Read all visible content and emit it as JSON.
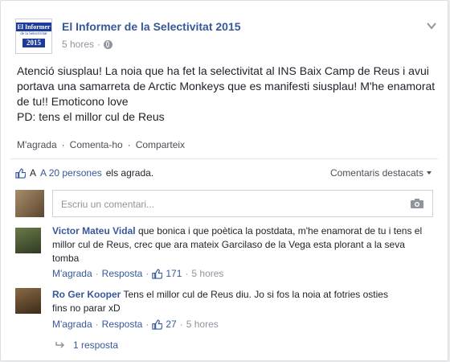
{
  "page": {
    "name": "El Informer de la Selectivitat 2015",
    "logo_text_top": "El Informer",
    "logo_text_mid": "de la Selectivitat",
    "logo_text_year": "2015",
    "time": "5 hores",
    "privacy_icon": "globe-icon"
  },
  "post": {
    "text": "Atenció siusplau! La noia que ha fet la selectivitat al INS Baix Camp de Reus i avui portava una samarreta de Arctic Monkeys que es manifesti siusplau! M'he enamorat de tu!! Emoticono love\nPD: tens el millor cul de Reus",
    "actions": {
      "like": "M'agrada",
      "comment": "Comenta-ho",
      "share": "Comparteix"
    }
  },
  "likes": {
    "prefix": "A",
    "count_label": "20 persones",
    "suffix": "els agrada.",
    "top_comments": "Comentaris destacats"
  },
  "comment_input": {
    "placeholder": "Escriu un comentari..."
  },
  "comments": [
    {
      "author": "Victor Mateu Vidal",
      "text": "que bonica i que poètica la postdata, m'he enamorat de tu i tens el millor cul de Reus, crec que ara mateix Garcilaso de la Vega esta plorant a la seva tomba",
      "like": "M'agrada",
      "reply": "Resposta",
      "likes": "171",
      "time": "5 hores"
    },
    {
      "author": "Ro Ger Kooper",
      "text": "Tens el millor cul de Reus diu. Jo si fos la noia at fotries osties fins no parar xD",
      "like": "M'agrada",
      "reply": "Resposta",
      "likes": "27",
      "time": "5 hores"
    }
  ],
  "replies_label": "1 resposta",
  "colors": {
    "link": "#365899",
    "text": "#1d2129",
    "muted": "#90949c",
    "page_bg": "#e9ebee"
  }
}
